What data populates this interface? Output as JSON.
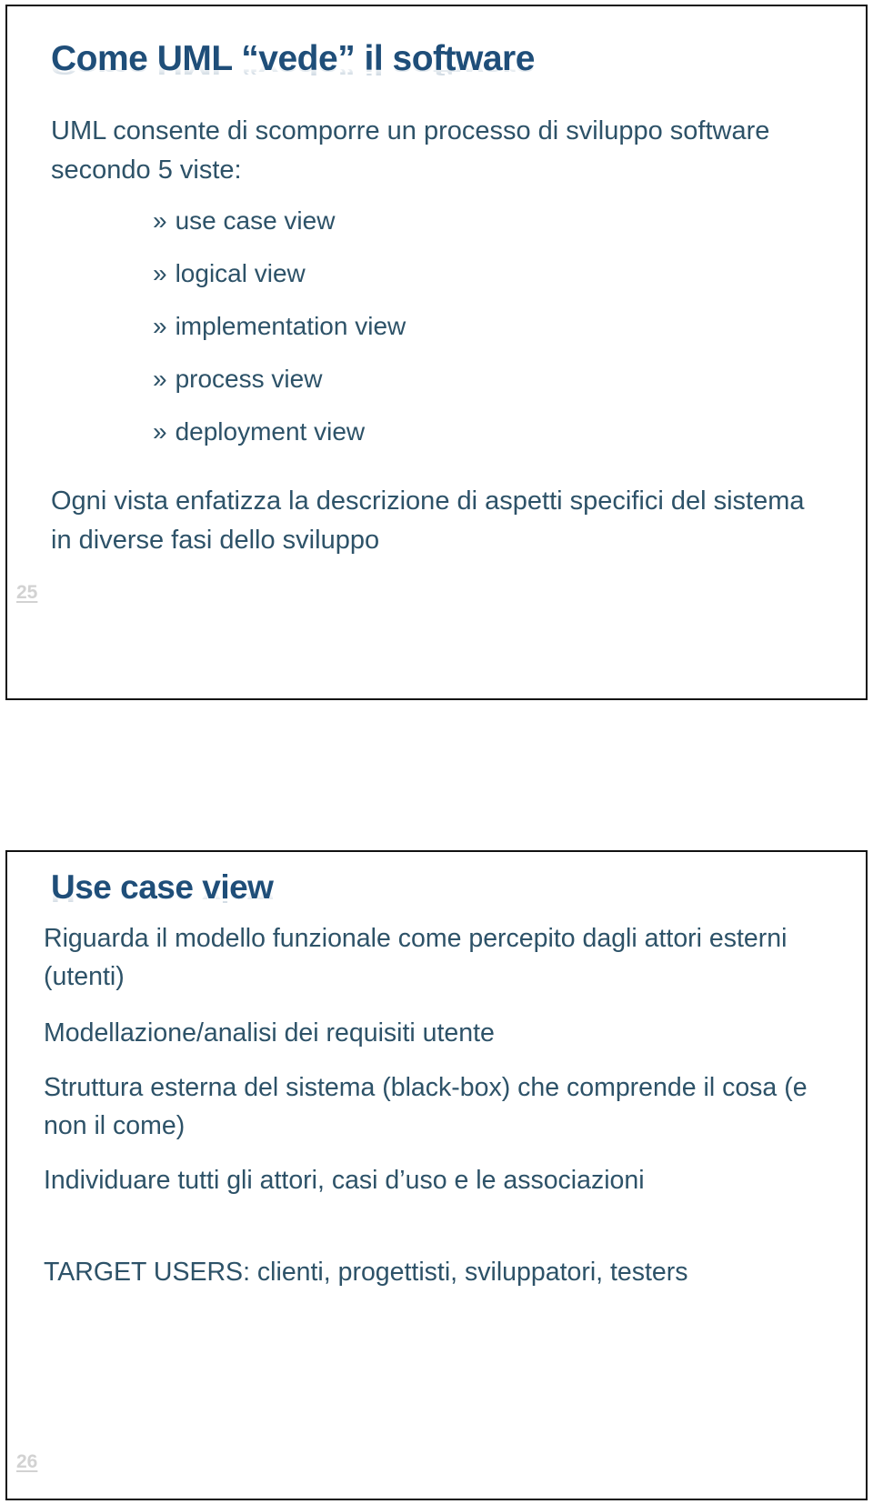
{
  "document": {
    "type": "lecture-slides-handout",
    "background_color": "#FFFFFF",
    "accent_title_color": "#1F4E79",
    "body_text_color": "#2D5268",
    "page_number_color": "#D2D2D2",
    "slide_border_color": "#111111"
  },
  "slides": [
    {
      "number": "25",
      "title": "Come UML “vede” il software",
      "intro": "UML consente di scomporre un processo di sviluppo software secondo 5 viste:",
      "bullet_marker": "»",
      "bullets": [
        "use case view",
        "logical view",
        "implementation view",
        "process view",
        "deployment view"
      ],
      "outro": "Ogni vista enfatizza la descrizione di aspetti specifici del sistema in diverse fasi dello sviluppo"
    },
    {
      "number": "26",
      "title": "Use case view",
      "paragraphs": [
        "Riguarda il modello funzionale come percepito dagli attori esterni (utenti)",
        "Modellazione/analisi dei requisiti utente",
        "Struttura esterna del sistema (black-box) che comprende il cosa (e non il come)",
        "Individuare tutti gli attori, casi d’uso e le associazioni",
        "TARGET USERS: clienti, progettisti, sviluppatori, testers"
      ]
    }
  ]
}
